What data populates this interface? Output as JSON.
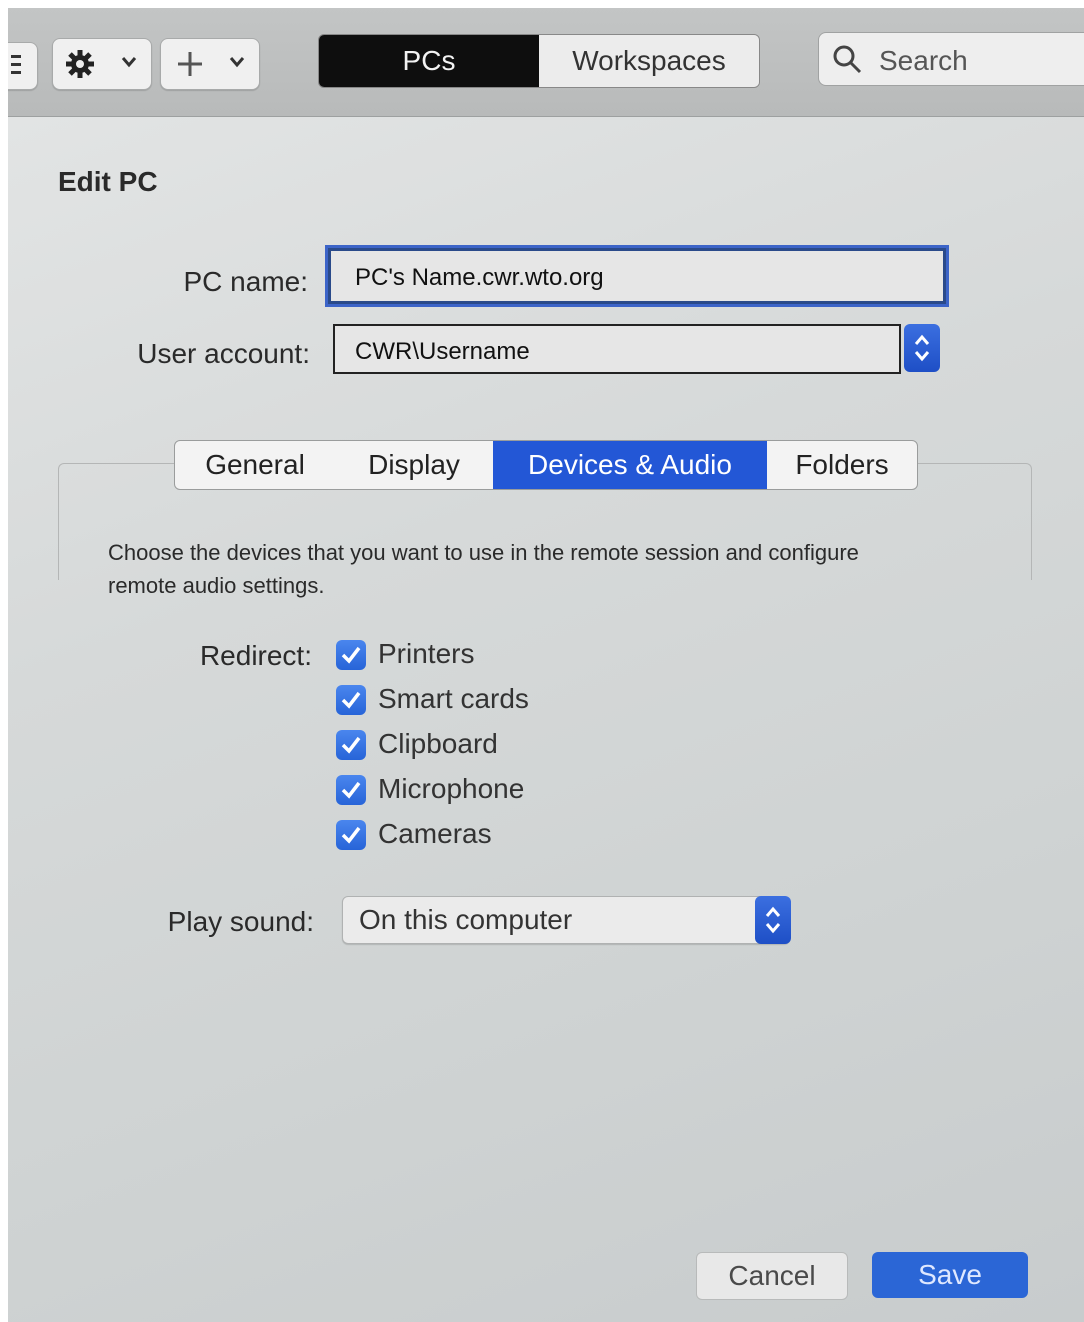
{
  "toolbar": {
    "segments": {
      "pcs": "PCs",
      "workspaces": "Workspaces"
    },
    "search_placeholder": "Search",
    "icons": [
      "sidebar-icon",
      "gear-icon",
      "chevron-down-icon",
      "plus-icon",
      "chevron-down-icon",
      "search-icon"
    ]
  },
  "dialog": {
    "title": "Edit PC",
    "pc_name_label": "PC name:",
    "pc_name_value": "PC's Name.cwr.wto.org",
    "user_account_label": "User account:",
    "user_account_value": "CWR\\Username",
    "tabs": [
      {
        "label": "General",
        "active": false
      },
      {
        "label": "Display",
        "active": false
      },
      {
        "label": "Devices & Audio",
        "active": true
      },
      {
        "label": "Folders",
        "active": false
      }
    ],
    "description": "Choose the devices that you want to use in the remote session and configure remote audio settings.",
    "redirect_label": "Redirect:",
    "redirect_items": [
      {
        "label": "Printers",
        "checked": true
      },
      {
        "label": "Smart cards",
        "checked": true
      },
      {
        "label": "Clipboard",
        "checked": true
      },
      {
        "label": "Microphone",
        "checked": true
      },
      {
        "label": "Cameras",
        "checked": true
      }
    ],
    "play_sound_label": "Play sound:",
    "play_sound_value": "On this computer",
    "cancel_label": "Cancel",
    "save_label": "Save"
  },
  "colors": {
    "accent": "#2357d6",
    "segment_active": "#0e0e0e",
    "checkbox": "#3a74e4"
  }
}
